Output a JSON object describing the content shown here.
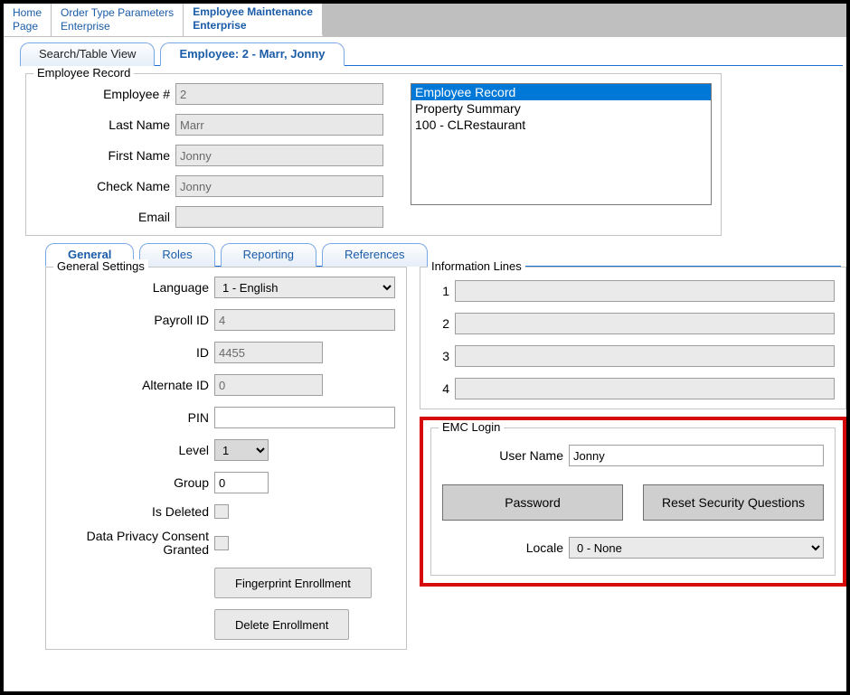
{
  "topTabs": {
    "home": {
      "label1": "Home",
      "label2": "Page"
    },
    "orderType": {
      "label1": "Order Type Parameters",
      "label2": "Enterprise"
    },
    "empMaint": {
      "label1": "Employee Maintenance",
      "label2": "Enterprise"
    }
  },
  "subTabs": {
    "search": "Search/Table View",
    "employee": "Employee: 2 - Marr, Jonny"
  },
  "record": {
    "title": "Employee Record",
    "labels": {
      "empNo": "Employee #",
      "lastName": "Last Name",
      "firstName": "First Name",
      "checkName": "Check Name",
      "email": "Email"
    },
    "values": {
      "empNo": "2",
      "lastName": "Marr",
      "firstName": "Jonny",
      "checkName": "Jonny",
      "email": ""
    },
    "listItems": [
      "Employee Record",
      "Property Summary",
      "100 - CLRestaurant"
    ]
  },
  "detailTabs": {
    "general": "General",
    "roles": "Roles",
    "reporting": "Reporting",
    "references": "References"
  },
  "general": {
    "title": "General Settings",
    "labels": {
      "language": "Language",
      "payrollId": "Payroll ID",
      "id": "ID",
      "altId": "Alternate ID",
      "pin": "PIN",
      "level": "Level",
      "group": "Group",
      "isDeleted": "Is Deleted",
      "consent": "Data Privacy Consent Granted"
    },
    "values": {
      "language": "1 - English",
      "payrollId": "4",
      "id": "4455",
      "altId": "0",
      "pin": "",
      "level": "1",
      "group": "0"
    },
    "buttons": {
      "fingerprint": "Fingerprint Enrollment",
      "delete": "Delete Enrollment"
    }
  },
  "info": {
    "title": "Information Lines",
    "labels": [
      "1",
      "2",
      "3",
      "4"
    ]
  },
  "emc": {
    "title": "EMC Login",
    "labels": {
      "userName": "User Name",
      "locale": "Locale"
    },
    "values": {
      "userName": "Jonny",
      "locale": "0 - None"
    },
    "buttons": {
      "password": "Password",
      "reset": "Reset Security Questions"
    }
  }
}
